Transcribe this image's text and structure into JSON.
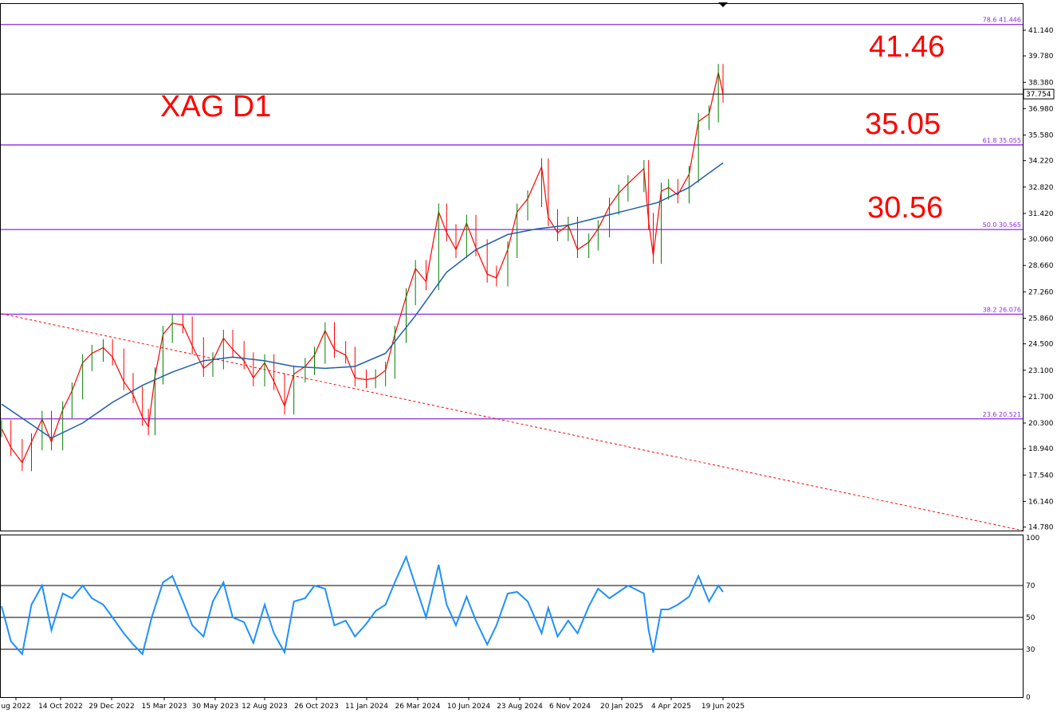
{
  "chart_data": [
    {
      "type": "line",
      "title": "XAG D1",
      "subtype": "candlestick price chart with moving average",
      "x_labels": [
        "ug 2022",
        "14 Oct 2022",
        "29 Dec 2022",
        "15 Mar 2023",
        "30 May 2023",
        "12 Aug 2023",
        "26 Oct 2023",
        "11 Jan 2024",
        "26 Mar 2024",
        "10 Jun 2024",
        "23 Aug 2024",
        "6 Nov 2024",
        "20 Jan 2025",
        "4 Apr 2025",
        "19 Jun 2025"
      ],
      "y_ticks": [
        "41.140",
        "39.780",
        "38.380",
        "36.980",
        "35.580",
        "34.220",
        "32.820",
        "31.420",
        "30.060",
        "28.660",
        "27.260",
        "25.860",
        "24.500",
        "23.100",
        "21.700",
        "20.300",
        "18.940",
        "17.540",
        "16.140",
        "14.780"
      ],
      "ylim": [
        14.78,
        42.53
      ],
      "current_price": "37.754",
      "price_series": {
        "x": [
          "2022-08-01",
          "2022-08-15",
          "2022-09-01",
          "2022-09-15",
          "2022-10-01",
          "2022-10-15",
          "2022-11-01",
          "2022-11-15",
          "2022-12-01",
          "2022-12-15",
          "2023-01-01",
          "2023-01-15",
          "2023-02-01",
          "2023-02-15",
          "2023-03-01",
          "2023-03-10",
          "2023-03-20",
          "2023-04-01",
          "2023-04-15",
          "2023-05-01",
          "2023-05-15",
          "2023-06-01",
          "2023-06-15",
          "2023-07-01",
          "2023-07-15",
          "2023-08-01",
          "2023-08-15",
          "2023-09-01",
          "2023-09-15",
          "2023-10-01",
          "2023-10-15",
          "2023-11-01",
          "2023-11-15",
          "2023-12-01",
          "2023-12-15",
          "2024-01-01",
          "2024-01-15",
          "2024-02-01",
          "2024-02-15",
          "2024-03-01",
          "2024-03-15",
          "2024-04-01",
          "2024-04-15",
          "2024-05-01",
          "2024-05-20",
          "2024-06-01",
          "2024-06-15",
          "2024-07-01",
          "2024-07-15",
          "2024-08-01",
          "2024-08-15",
          "2024-09-01",
          "2024-09-15",
          "2024-10-01",
          "2024-10-22",
          "2024-11-01",
          "2024-11-15",
          "2024-12-01",
          "2024-12-15",
          "2025-01-01",
          "2025-01-15",
          "2025-02-01",
          "2025-02-15",
          "2025-03-01",
          "2025-03-25",
          "2025-04-01",
          "2025-04-08",
          "2025-04-20",
          "2025-05-01",
          "2025-05-15",
          "2025-06-01",
          "2025-06-15",
          "2025-07-01",
          "2025-07-15",
          "2025-07-22"
        ],
        "values": [
          20.0,
          19.0,
          18.2,
          19.3,
          20.5,
          19.3,
          21.0,
          22.0,
          23.5,
          24.0,
          24.3,
          23.8,
          22.5,
          21.8,
          20.6,
          20.1,
          22.8,
          25.0,
          25.6,
          25.5,
          24.4,
          23.2,
          23.6,
          24.8,
          24.2,
          23.6,
          22.7,
          23.5,
          22.5,
          21.2,
          22.9,
          23.3,
          23.9,
          25.2,
          24.2,
          23.9,
          22.7,
          22.6,
          22.7,
          23.1,
          25.0,
          27.0,
          28.5,
          27.8,
          31.5,
          30.4,
          29.5,
          30.9,
          29.6,
          28.2,
          28.0,
          29.5,
          31.5,
          32.2,
          33.9,
          31.2,
          30.4,
          30.8,
          29.5,
          29.9,
          30.6,
          31.8,
          32.5,
          33.0,
          33.8,
          31.0,
          29.2,
          32.6,
          32.8,
          32.4,
          33.5,
          36.3,
          36.7,
          38.9,
          37.754
        ]
      },
      "moving_average": {
        "x": [
          "2022-08-01",
          "2022-10-15",
          "2022-12-01",
          "2023-01-15",
          "2023-03-01",
          "2023-04-15",
          "2023-06-01",
          "2023-07-15",
          "2023-09-01",
          "2023-10-15",
          "2023-12-01",
          "2024-01-15",
          "2024-03-01",
          "2024-04-15",
          "2024-06-01",
          "2024-07-15",
          "2024-09-01",
          "2024-10-15",
          "2024-12-01",
          "2025-01-15",
          "2025-03-01",
          "2025-04-15",
          "2025-06-01",
          "2025-07-22"
        ],
        "values": [
          21.3,
          19.5,
          20.3,
          21.4,
          22.3,
          23.0,
          23.6,
          23.8,
          23.6,
          23.3,
          23.2,
          23.3,
          24.0,
          26.0,
          28.3,
          29.5,
          30.3,
          30.6,
          30.8,
          31.2,
          31.6,
          32.0,
          32.8,
          34.1
        ]
      },
      "fibonacci_levels": [
        {
          "label": "78.6 41.446",
          "value": 41.446
        },
        {
          "label": "61.8 35.055",
          "value": 35.055
        },
        {
          "label": "50.0 30.565",
          "value": 30.565
        },
        {
          "label": "38.2 26.076",
          "value": 26.076
        },
        {
          "label": "23.6 20.521",
          "value": 20.521
        }
      ],
      "trendline": {
        "from": {
          "x": "2022-08-01",
          "y": 26.1
        },
        "to": {
          "x": "2025-10-20",
          "y": 17.3
        },
        "style": "dashed"
      },
      "annotations": [
        "41.46",
        "35.05",
        "30.56"
      ],
      "colors": {
        "price": "#ff0000",
        "bull": "#008000",
        "ma": "#1f5fa8",
        "fib": "#8a2be2",
        "trend": "#ff0000",
        "annotation": "#ff0000"
      }
    },
    {
      "type": "line",
      "title": "",
      "subtype": "oscillator",
      "ylim": [
        0,
        100
      ],
      "y_ticks": [
        "100",
        "70",
        "50",
        "30",
        "0"
      ],
      "levels": [
        70,
        50,
        30
      ],
      "series": {
        "x": [
          "2022-08-01",
          "2022-08-15",
          "2022-09-01",
          "2022-09-15",
          "2022-10-01",
          "2022-10-15",
          "2022-11-01",
          "2022-11-15",
          "2022-12-01",
          "2022-12-15",
          "2023-01-01",
          "2023-01-15",
          "2023-02-01",
          "2023-02-15",
          "2023-03-01",
          "2023-03-15",
          "2023-04-01",
          "2023-04-15",
          "2023-05-01",
          "2023-05-15",
          "2023-06-01",
          "2023-06-15",
          "2023-07-01",
          "2023-07-15",
          "2023-08-01",
          "2023-08-15",
          "2023-09-01",
          "2023-09-15",
          "2023-10-01",
          "2023-10-15",
          "2023-11-01",
          "2023-11-15",
          "2023-12-01",
          "2023-12-15",
          "2024-01-01",
          "2024-01-15",
          "2024-02-01",
          "2024-02-15",
          "2024-03-01",
          "2024-03-15",
          "2024-04-01",
          "2024-04-15",
          "2024-05-01",
          "2024-05-20",
          "2024-06-01",
          "2024-06-15",
          "2024-07-01",
          "2024-07-15",
          "2024-08-01",
          "2024-08-15",
          "2024-09-01",
          "2024-09-15",
          "2024-10-01",
          "2024-10-22",
          "2024-11-01",
          "2024-11-15",
          "2024-12-01",
          "2024-12-15",
          "2025-01-01",
          "2025-01-15",
          "2025-02-01",
          "2025-02-15",
          "2025-03-01",
          "2025-03-25",
          "2025-04-01",
          "2025-04-08",
          "2025-04-20",
          "2025-05-01",
          "2025-05-15",
          "2025-06-01",
          "2025-06-15",
          "2025-07-01",
          "2025-07-15",
          "2025-07-22"
        ],
        "values": [
          57,
          35,
          27,
          58,
          70,
          42,
          65,
          62,
          70,
          62,
          58,
          50,
          40,
          33,
          27,
          50,
          72,
          76,
          60,
          45,
          38,
          60,
          72,
          50,
          47,
          34,
          58,
          40,
          28,
          60,
          62,
          70,
          68,
          45,
          48,
          38,
          46,
          54,
          58,
          72,
          88,
          70,
          50,
          83,
          58,
          45,
          63,
          48,
          33,
          45,
          65,
          66,
          60,
          40,
          56,
          38,
          48,
          40,
          57,
          68,
          62,
          66,
          70,
          65,
          42,
          28,
          55,
          55,
          58,
          63,
          76,
          60,
          70,
          66
        ]
      },
      "colors": {
        "line": "#1e90ff"
      }
    }
  ]
}
